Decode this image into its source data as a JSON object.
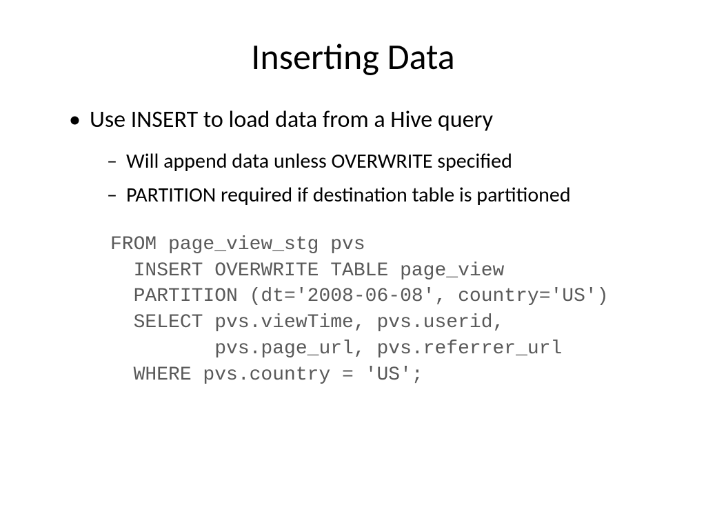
{
  "title": "Inserting Data",
  "bullets": {
    "main": "Use INSERT to load data from a Hive query",
    "sub1": "Will append data unless OVERWRITE specified",
    "sub2": "PARTITION required if destination table is partitioned"
  },
  "code": {
    "line1": "FROM page_view_stg pvs",
    "line2": "  INSERT OVERWRITE TABLE page_view",
    "line3": "  PARTITION (dt='2008-06-08', country='US')",
    "line4": "  SELECT pvs.viewTime, pvs.userid,",
    "line5": "         pvs.page_url, pvs.referrer_url",
    "line6": "  WHERE pvs.country = 'US';"
  }
}
